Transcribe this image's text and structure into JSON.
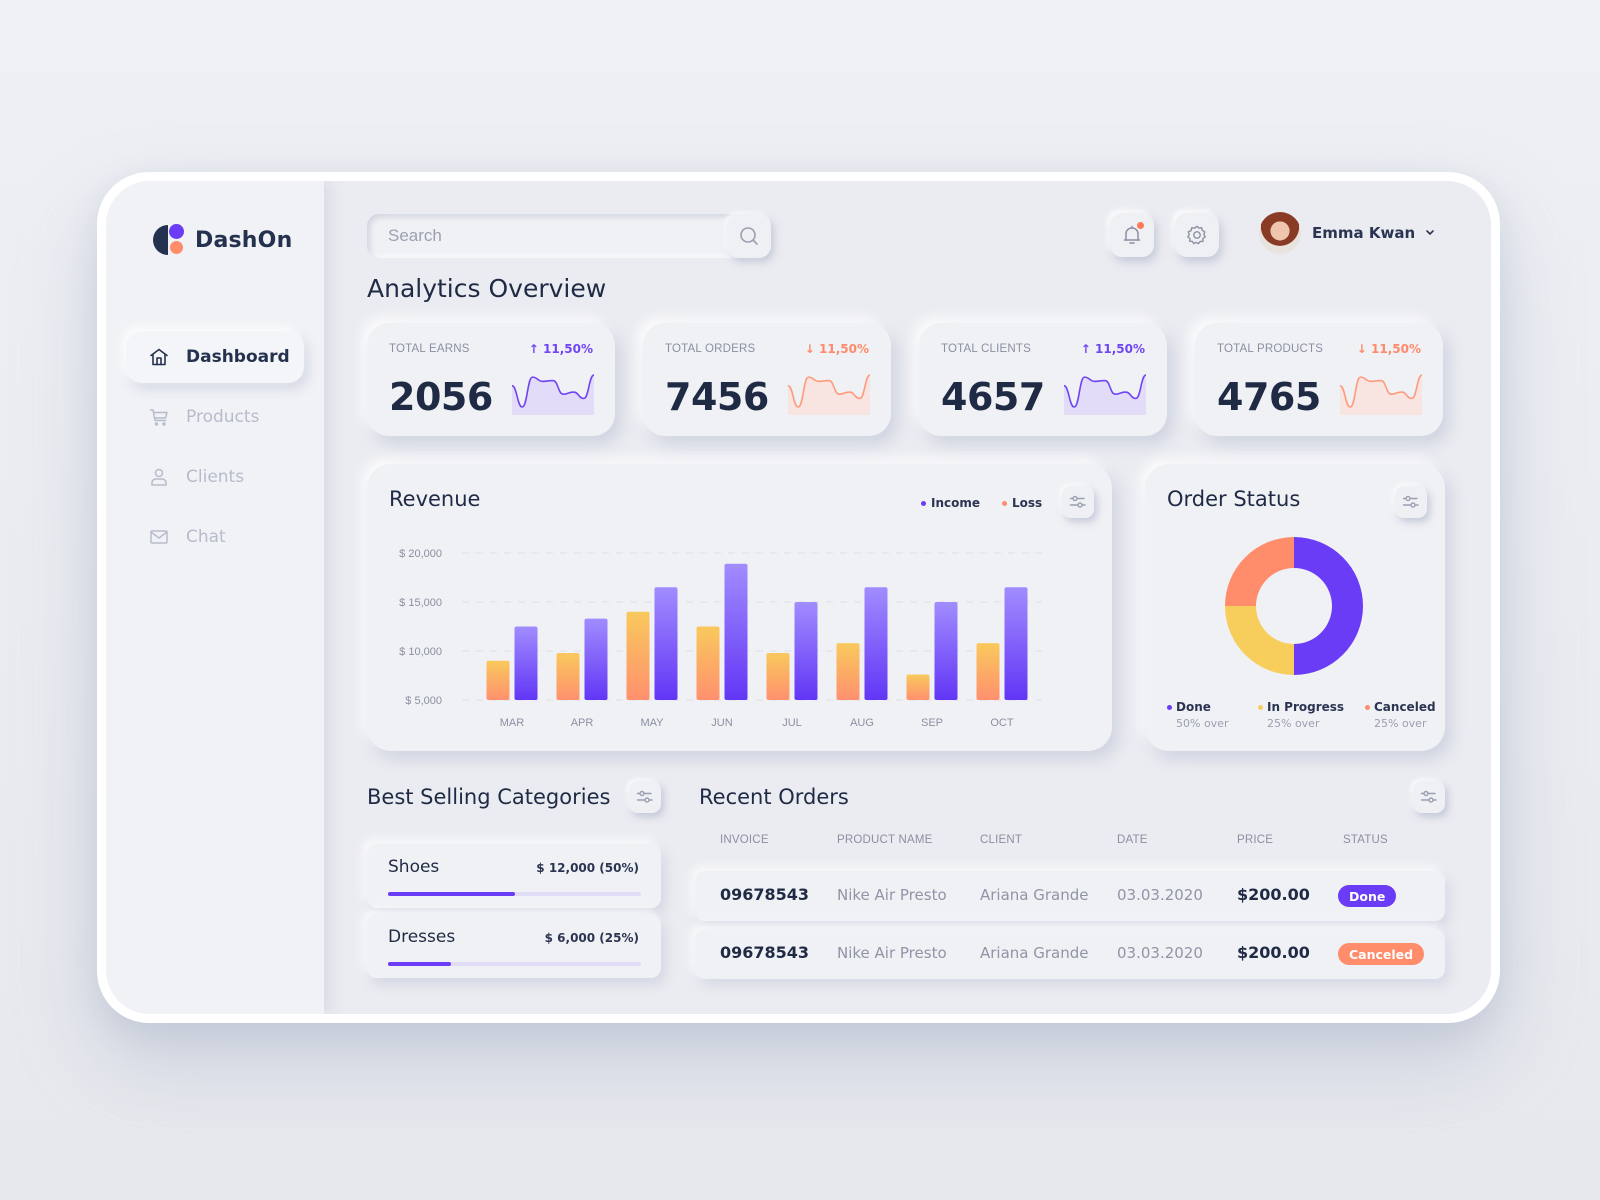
{
  "app": {
    "name": "DashOn",
    "colors": {
      "primary": "#6a3cf5",
      "accent": "#ff8c6b",
      "yellow": "#f7cd5b",
      "text": "#1f2a44",
      "muted": "#8a90a2"
    }
  },
  "sidebar": {
    "items": [
      {
        "label": "Dashboard",
        "icon": "home-icon",
        "active": true
      },
      {
        "label": "Products",
        "icon": "cart-icon",
        "active": false
      },
      {
        "label": "Clients",
        "icon": "user-icon",
        "active": false
      },
      {
        "label": "Chat",
        "icon": "mail-icon",
        "active": false
      }
    ]
  },
  "header": {
    "search_placeholder": "Search",
    "search_value": "",
    "notifications_icon": "bell-icon",
    "has_unread_notifications": true,
    "settings_icon": "gear-icon",
    "user_name": "Emma Kwan",
    "user_menu_icon": "chevron-down-icon"
  },
  "page": {
    "title": "Analytics Overview"
  },
  "stats": [
    {
      "label": "TOTAL EARNS",
      "value": "2056",
      "change": "11,50%",
      "direction": "up",
      "arrow": "↑"
    },
    {
      "label": "TOTAL ORDERS",
      "value": "7456",
      "change": "11,50%",
      "direction": "down",
      "arrow": "↓"
    },
    {
      "label": "TOTAL CLIENTS",
      "value": "4657",
      "change": "11,50%",
      "direction": "up",
      "arrow": "↑"
    },
    {
      "label": "TOTAL PRODUCTS",
      "value": "4765",
      "change": "11,50%",
      "direction": "down",
      "arrow": "↓"
    }
  ],
  "revenue": {
    "title": "Revenue",
    "legend": [
      {
        "label": "Income",
        "color": "#6a3cf5"
      },
      {
        "label": "Loss",
        "color": "#ff8c6b"
      }
    ]
  },
  "order_status": {
    "title": "Order Status",
    "segments": [
      {
        "label": "Done",
        "sub": "50% over",
        "value": 50,
        "color": "#6a3cf5"
      },
      {
        "label": "In Progress",
        "sub": "25% over",
        "value": 25,
        "color": "#f7cd5b"
      },
      {
        "label": "Canceled",
        "sub": "25% over",
        "value": 25,
        "color": "#ff8c6b"
      }
    ]
  },
  "best_selling": {
    "title": "Best Selling Categories",
    "items": [
      {
        "name": "Shoes",
        "value": "$ 12,000 (50%)",
        "fraction": 0.5
      },
      {
        "name": "Dresses",
        "value": "$ 6,000 (25%)",
        "fraction": 0.25
      }
    ]
  },
  "recent_orders": {
    "title": "Recent Orders",
    "columns": [
      "INVOICE",
      "PRODUCT NAME",
      "CLIENT",
      "DATE",
      "PRICE",
      "STATUS"
    ],
    "rows": [
      {
        "invoice": "09678543",
        "product": "Nike Air Presto",
        "client": "Ariana Grande",
        "date": "03.03.2020",
        "price": "$200.00",
        "status": "Done",
        "status_color": "#6a3cf5"
      },
      {
        "invoice": "09678543",
        "product": "Nike Air Presto",
        "client": "Ariana Grande",
        "date": "03.03.2020",
        "price": "$200.00",
        "status": "Canceled",
        "status_color": "#ff8c6b"
      }
    ]
  },
  "chart_data": [
    {
      "type": "bar",
      "title": "Revenue",
      "xlabel": "",
      "ylabel": "",
      "categories": [
        "MAR",
        "APR",
        "MAY",
        "JUN",
        "JUL",
        "AUG",
        "SEP",
        "OCT"
      ],
      "series": [
        {
          "name": "Loss",
          "color": "#ff8c6b",
          "values": [
            9000,
            9800,
            14000,
            12500,
            9800,
            10800,
            7600,
            10800
          ]
        },
        {
          "name": "Income",
          "color": "#6a3cf5",
          "values": [
            12500,
            13300,
            16500,
            18900,
            15000,
            16500,
            15000,
            16500
          ]
        }
      ],
      "yticks": [
        5000,
        10000,
        15000,
        20000
      ],
      "ytick_labels": [
        "$ 5,000",
        "$ 10,000",
        "$ 15,000",
        "$ 20,000"
      ],
      "ylim": [
        5000,
        20000
      ],
      "grid": true,
      "legend": "top-right"
    },
    {
      "type": "pie",
      "title": "Order Status",
      "categories": [
        "Done",
        "In Progress",
        "Canceled"
      ],
      "values": [
        50,
        25,
        25
      ],
      "donut": true,
      "legend": "bottom"
    },
    {
      "type": "line",
      "title": "Total Earns sparkline",
      "values": [
        6,
        1,
        8,
        7,
        7.2,
        4,
        4.5,
        3,
        8.5
      ]
    }
  ]
}
